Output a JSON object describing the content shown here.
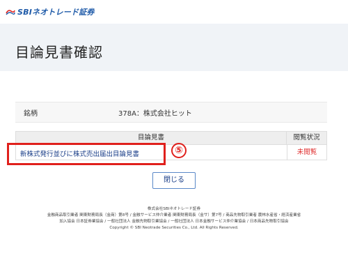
{
  "header": {
    "logo_text": "SBIネオトレード証券",
    "page_title": "目論見書確認"
  },
  "brand": {
    "label": "銘柄",
    "value": "378A：株式会社ヒット"
  },
  "table": {
    "col_document": "目論見書",
    "col_status": "閲覧状況",
    "rows": [
      {
        "document": "新株式発行並びに株式売出届出目論見書",
        "status": "未閲覧"
      }
    ]
  },
  "annotation": {
    "step": "⑤",
    "color": "#e0201c"
  },
  "actions": {
    "close_label": "閉じる"
  },
  "footer": {
    "line1": "株式会社SBIネオトレード証券",
    "line2": "金融商品取引業者 関東財務局長（金商）第8号 / 金融サービス仲介業者 関東財務局長（金サ）第7号 / 商品先物取引業者 農林水産省・経済産業省",
    "line3": "加入協会 日本証券業協会 / 一般社団法人 金融先物取引業協会 / 一般社団法人 日本金融サービス仲介業協会 / 日本商品先物取引協会",
    "line4": "Copyright © SBI Neotrade Securities Co., Ltd. All Rights Reserved."
  },
  "colors": {
    "brand_blue": "#1e5aa8",
    "link": "#1a3e88",
    "unread": "#e03030",
    "title_band": "#f0f3f7"
  }
}
